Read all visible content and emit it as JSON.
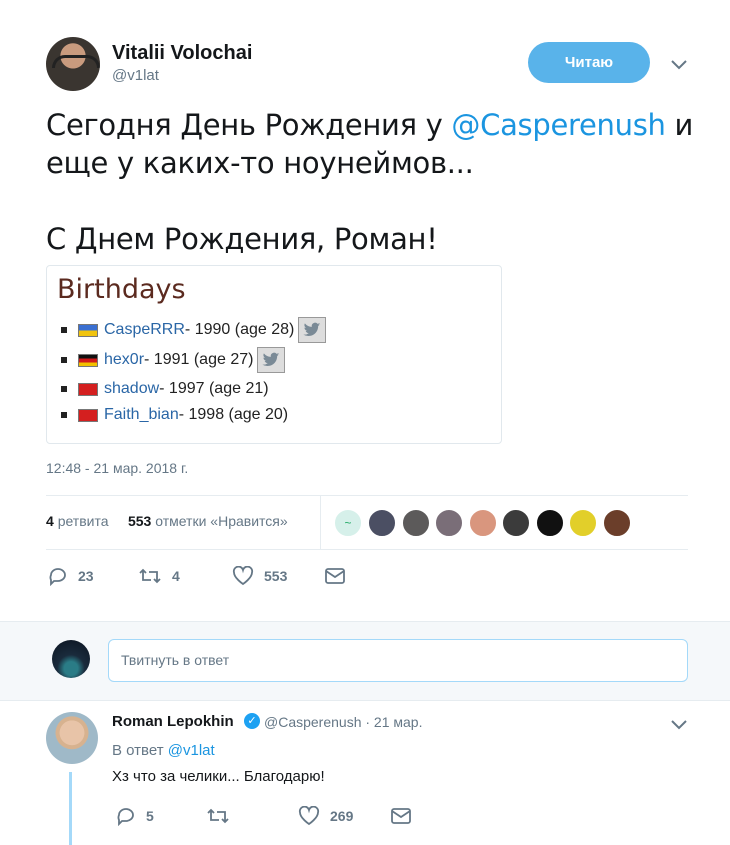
{
  "tweet": {
    "author_name": "Vitalii Volochai",
    "author_handle": "@v1lat",
    "follow_label": "Читаю",
    "text_before": "Сегодня День Рождения у ",
    "mention": "@Casperenush",
    "text_after": " и еще у каких-то ноунеймов...",
    "text_line2": "С Днем Рождения, Роман!",
    "timestamp": "12:48 - 21 мар. 2018 г.",
    "retweets_count": "4",
    "retweets_label": "ретвита",
    "likes_count": "553",
    "likes_label": "отметки «Нравится»",
    "actions": {
      "replies": "23",
      "retweets": "4",
      "likes": "553"
    }
  },
  "card": {
    "title": "Birthdays",
    "items": [
      {
        "name": "CaspeRRR",
        "info": " - 1990 (age 28)",
        "flag": "ua",
        "twitter": true
      },
      {
        "name": "hex0r",
        "info": " - 1991 (age 27)",
        "flag": "de",
        "twitter": true
      },
      {
        "name": "shadow",
        "info": " - 1997 (age 21)",
        "flag": "cn",
        "twitter": false
      },
      {
        "name": "Faith_bian",
        "info": " - 1998 (age 20)",
        "flag": "cn",
        "twitter": false
      }
    ]
  },
  "likers": [
    {
      "color": "#d6f0ea",
      "mark": "~"
    },
    {
      "color": "#4b4f63"
    },
    {
      "color": "#5c5a5a"
    },
    {
      "color": "#7a6e78"
    },
    {
      "color": "#d9967e"
    },
    {
      "color": "#3b3b3b"
    },
    {
      "color": "#111111"
    },
    {
      "color": "#e2cf2a"
    },
    {
      "color": "#6b3e2a"
    },
    {
      "color": "#b8c0c8"
    }
  ],
  "reply_box": {
    "placeholder": "Твитнуть в ответ"
  },
  "reply": {
    "author_name": "Roman Lepokhin",
    "meta": "@Casperenush · 21 мар.",
    "reply_to_prefix": "В ответ ",
    "reply_to_handle": "@v1lat",
    "text": "Хз что за челики... Благодарю!",
    "actions": {
      "replies": "5",
      "retweets": "",
      "likes": "269"
    }
  },
  "colors": {
    "accent": "#1da1f2",
    "follow_button": "#59b3ea",
    "link": "#1b95e0"
  }
}
